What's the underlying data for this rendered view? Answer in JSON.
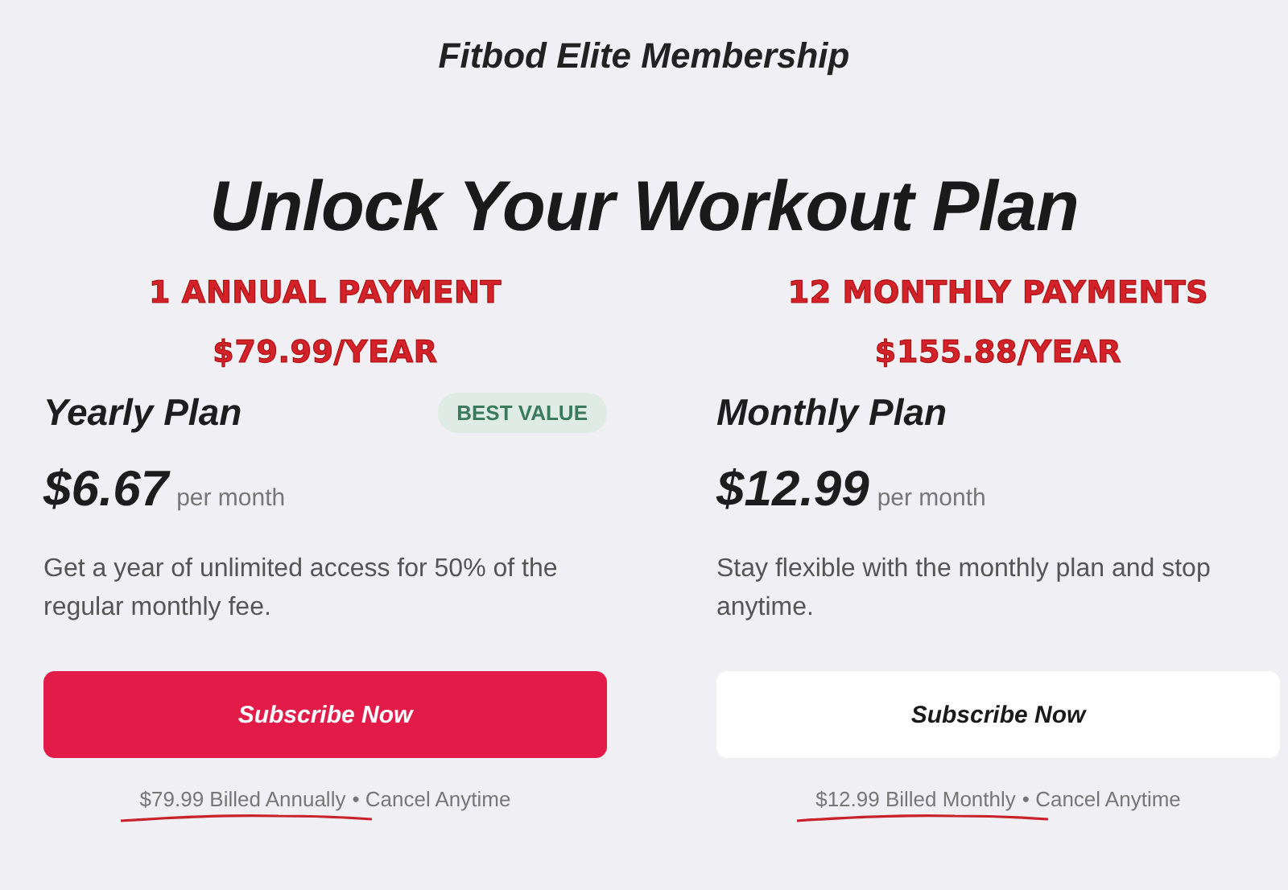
{
  "header": {
    "title": "Fitbod Elite Membership"
  },
  "headline": "Unlock Your Workout Plan",
  "plans": [
    {
      "note": [
        "1 ANNUAL PAYMENT",
        "$79.99/YEAR"
      ],
      "name": "Yearly Plan",
      "badge": "BEST VALUE",
      "price": "$6.67",
      "period": "per month",
      "description": "Get a year of unlimited access for 50% of the regular monthly fee.",
      "button": {
        "label": "Subscribe Now",
        "kind": "primary"
      },
      "billing": "$79.99 Billed Annually",
      "cancel": "• Cancel Anytime"
    },
    {
      "note": [
        "12 MONTHLY PAYMENTS",
        "$155.88/YEAR"
      ],
      "name": "Monthly Plan",
      "price": "$12.99",
      "period": "per month",
      "description": "Stay flexible with the monthly plan and stop anytime.",
      "button": {
        "label": "Subscribe Now",
        "kind": "secondary"
      },
      "billing": "$12.99 Billed Monthly",
      "cancel": "• Cancel Anytime"
    }
  ]
}
